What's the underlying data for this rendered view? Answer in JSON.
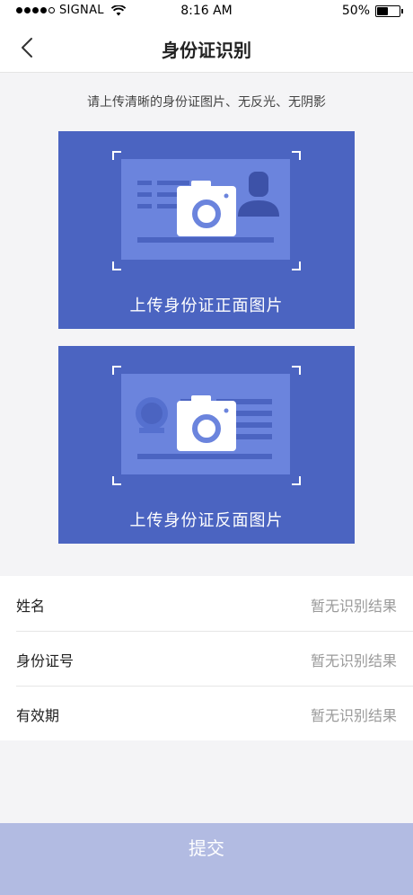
{
  "status_bar": {
    "carrier": "SIGNAL",
    "time": "8:16 AM",
    "battery": "50%",
    "battery_level": 0.5,
    "signal_dots_filled": 4
  },
  "nav": {
    "title": "身份证识别",
    "back_icon": "chevron-left-icon"
  },
  "tip": "请上传清晰的身份证图片、无反光、无阴影",
  "cards": {
    "front_label": "上传身份证正面图片",
    "back_label": "上传身份证反面图片",
    "camera_icon": "camera-icon"
  },
  "form": {
    "rows": [
      {
        "label": "姓名",
        "value": "暂无识别结果"
      },
      {
        "label": "身份证号",
        "value": "暂无识别结果"
      },
      {
        "label": "有效期",
        "value": "暂无识别结果"
      }
    ]
  },
  "submit_label": "提交",
  "colors": {
    "card": "#4b64c1",
    "card_inner": "#6b84dd",
    "submit": "#b2bbe2"
  }
}
